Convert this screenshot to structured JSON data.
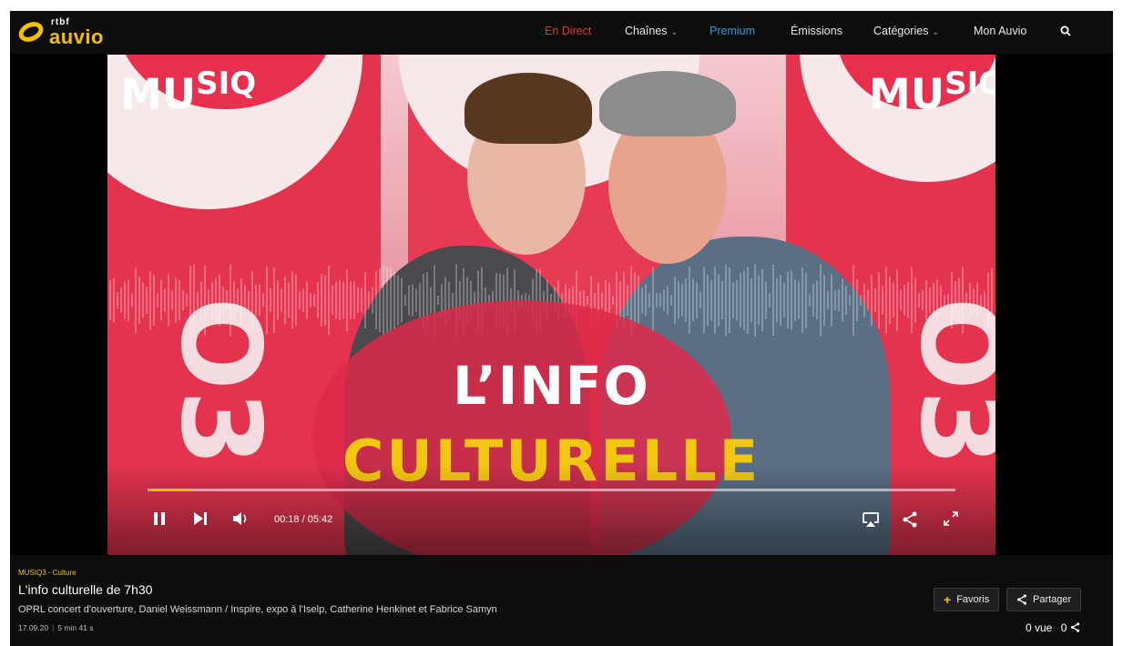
{
  "brand": {
    "small": "rtbf",
    "big": "auvio",
    "accent": "#f5c000"
  },
  "nav": {
    "items": [
      {
        "label": "En Direct",
        "color": "#e4372c"
      },
      {
        "label": "Chaînes"
      },
      {
        "label": "Premium",
        "color": "#2e9bdc"
      },
      {
        "label": "Émissions"
      },
      {
        "label": "Catégories"
      },
      {
        "label": "Mon Auvio"
      }
    ],
    "search_icon": "search-icon"
  },
  "video": {
    "background_text": {
      "mu": "MU",
      "sup": "SIQ",
      "number": "O3"
    },
    "overlay_title_line1": "L’INFO",
    "overlay_title_line2": "CULTURELLE",
    "progress": 0.053
  },
  "player": {
    "time": "00:18 / 05:42",
    "icons": [
      "pause-icon",
      "next-icon",
      "volume-icon",
      "airplay-icon",
      "share-icon",
      "fullscreen-icon"
    ]
  },
  "episode": {
    "kicker": "MUSIQ3 - Culture",
    "title": "L'info culturelle de 7h30",
    "description": "OPRL concert d'ouverture, Daniel Weissmann / Inspire, expo à l'Iselp, Catherine Henkinet et Fabrice Samyn",
    "date": "17.09.20",
    "duration": "5 min 41 s",
    "favorites_label": "Favoris",
    "share_label": "Partager",
    "views": "0 vue",
    "shares": "0"
  }
}
